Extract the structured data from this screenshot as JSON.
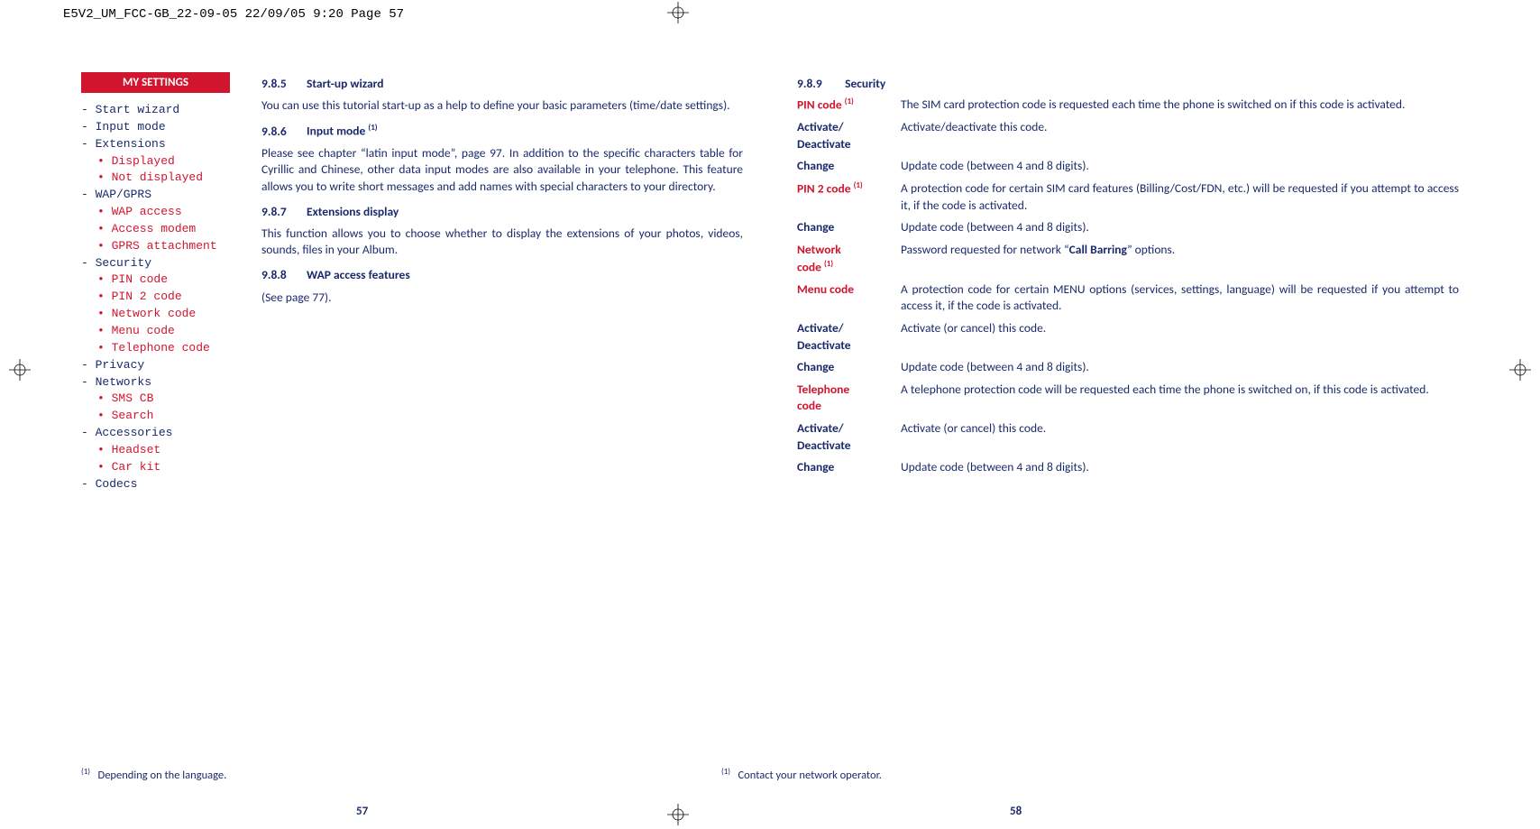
{
  "header": "E5V2_UM_FCC-GB_22-09-05  22/09/05  9:20  Page 57",
  "tab": "MY SETTINGS",
  "sidebar": [
    {
      "t": "top",
      "dash": true,
      "label": "Start wizard"
    },
    {
      "t": "top",
      "dash": true,
      "label": "Input mode"
    },
    {
      "t": "top",
      "dash": true,
      "label": "Extensions"
    },
    {
      "t": "sub",
      "label": "Displayed"
    },
    {
      "t": "sub",
      "label": "Not displayed"
    },
    {
      "t": "top",
      "dash": true,
      "label": "WAP/GPRS"
    },
    {
      "t": "sub",
      "label": "WAP access"
    },
    {
      "t": "sub",
      "label": "Access modem"
    },
    {
      "t": "sub",
      "label": "GPRS attachment"
    },
    {
      "t": "top",
      "dash": true,
      "label": "Security"
    },
    {
      "t": "sub",
      "label": "PIN code"
    },
    {
      "t": "sub",
      "label": "PIN 2 code"
    },
    {
      "t": "sub",
      "label": "Network code"
    },
    {
      "t": "sub",
      "label": "Menu code"
    },
    {
      "t": "sub",
      "label": "Telephone code"
    },
    {
      "t": "top",
      "dash": true,
      "label": "Privacy"
    },
    {
      "t": "top",
      "dash": true,
      "label": "Networks"
    },
    {
      "t": "sub",
      "label": "SMS CB"
    },
    {
      "t": "sub",
      "label": "Search"
    },
    {
      "t": "top",
      "dash": true,
      "label": "Accessories"
    },
    {
      "t": "sub",
      "label": "Headset"
    },
    {
      "t": "sub",
      "label": "Car kit"
    },
    {
      "t": "top",
      "dash": true,
      "label": "Codecs"
    }
  ],
  "left_sections": [
    {
      "num": "9.8.5",
      "title": "Start-up wizard",
      "paras": [
        "You can use this tutorial start-up as a help to define your basic parameters (time/date settings)."
      ]
    },
    {
      "num": "9.8.6",
      "title": "Input mode",
      "sup": "(1)",
      "paras": [
        "Please see chapter “latin input mode”, page 97. In addition to the specific characters table for Cyrillic and Chinese, other data input modes are also available in your telephone. This feature allows you to write short messages and add names with special characters to your directory."
      ]
    },
    {
      "num": "9.8.7",
      "title": "Extensions display",
      "paras": [
        "This function allows you to choose whether to display the extensions of your photos, videos, sounds, files in your Album."
      ]
    },
    {
      "num": "9.8.8",
      "title": "WAP access features",
      "paras": [
        "(See page 77)."
      ]
    }
  ],
  "right_head": {
    "num": "9.8.9",
    "title": "Security"
  },
  "defs": [
    {
      "term": "PIN code",
      "sup": "(1)",
      "red": true,
      "body": "The SIM card protection code is requested each time the phone is switched on if this code is activated."
    },
    {
      "term": "Activate/ Deactivate",
      "red": false,
      "body": "Activate/deactivate this code."
    },
    {
      "term": "Change",
      "red": false,
      "body": "Update code (between 4 and 8 digits)."
    },
    {
      "term": "PIN 2 code",
      "sup": "(1)",
      "red": true,
      "body": "A protection code for certain SIM card features (Billing/Cost/FDN, etc.) will be requested if you attempt to access it, if the code is activated."
    },
    {
      "term": "Change",
      "red": false,
      "body": "Update code (between 4 and 8 digits)."
    },
    {
      "term": "Network code",
      "sup": "(1)",
      "red": true,
      "body_html": "Password requested for network “<b>Call Barring</b>” options."
    },
    {
      "term": "Menu code",
      "red": true,
      "body": "A protection code for certain MENU options (services, settings, language) will be requested if you attempt to access it, if the code is activated."
    },
    {
      "term": "Activate/ Deactivate",
      "red": false,
      "body": "Activate (or cancel) this code."
    },
    {
      "term": "Change",
      "red": false,
      "body": "Update code (between 4 and 8 digits)."
    },
    {
      "term": "Telephone code",
      "red": true,
      "body": "A telephone protection code will be requested each time the phone is switched on, if this code is activated."
    },
    {
      "term": "Activate/ Deactivate",
      "red": false,
      "body": "Activate (or cancel) this code."
    },
    {
      "term": "Change",
      "red": false,
      "body": "Update code (between 4 and 8 digits)."
    }
  ],
  "footnote_left": {
    "mark": "(1)",
    "text": "Depending on the language."
  },
  "footnote_right": {
    "mark": "(1)",
    "text": "Contact your network operator."
  },
  "page_left": "57",
  "page_right": "58"
}
